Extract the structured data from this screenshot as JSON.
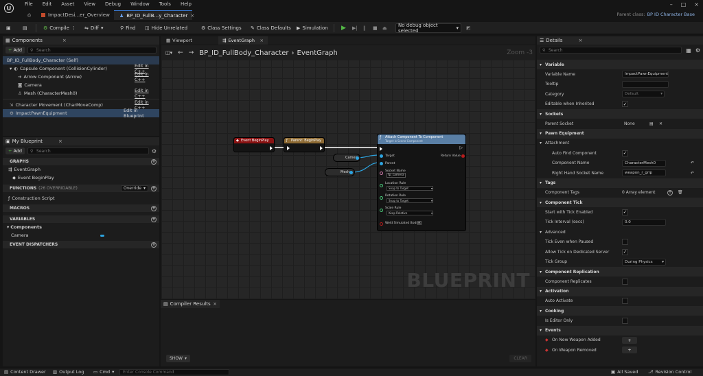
{
  "menu": [
    "File",
    "Edit",
    "Asset",
    "View",
    "Debug",
    "Window",
    "Tools",
    "Help"
  ],
  "doc_tabs": [
    {
      "label": "ImpactDesi...er_Overview"
    },
    {
      "label": "BP_ID_FullB...y_Character"
    }
  ],
  "parent_class": {
    "label": "Parent class:",
    "value": "BP ID Character Base"
  },
  "toolbar": {
    "compile": "Compile",
    "diff": "Diff",
    "find": "Find",
    "hide_unrelated": "Hide Unrelated",
    "class_settings": "Class Settings",
    "class_defaults": "Class Defaults",
    "simulation": "Simulation",
    "debug_object": "No debug object selected"
  },
  "components": {
    "title": "Components",
    "add": "Add",
    "search_placeholder": "Search",
    "items": [
      {
        "label": "BP_ID_FullBody_Character (Self)",
        "edit": ""
      },
      {
        "label": "Capsule Component (CollisionCylinder)",
        "edit": "Edit in C++"
      },
      {
        "label": "Arrow Component (Arrow)",
        "edit": "Edit in C++"
      },
      {
        "label": "Camera",
        "edit": ""
      },
      {
        "label": "Mesh (CharacterMesh0)",
        "edit": "Edit in C++"
      },
      {
        "label": "Character Movement (CharMoveComp)",
        "edit": "Edit in C++"
      },
      {
        "label": "ImpactPawnEquipment",
        "edit": "Edit in Blueprint"
      }
    ]
  },
  "my_blueprint": {
    "title": "My Blueprint",
    "add": "Add",
    "search_placeholder": "Search",
    "graphs": "GRAPHS",
    "event_graph": "EventGraph",
    "event_begin_play": "Event BeginPlay",
    "functions": "FUNCTIONS",
    "functions_note": "(26 OVERRIDABLE)",
    "override": "Override",
    "construction_script": "Construction Script",
    "macros": "MACROS",
    "variables": "VARIABLES",
    "components_cat": "Components",
    "camera_var": "Camera",
    "event_dispatchers": "EVENT DISPATCHERS"
  },
  "graph": {
    "tab_viewport": "Viewport",
    "tab_event_graph": "EventGraph",
    "breadcrumb_bp": "BP_ID_FullBody_Character",
    "breadcrumb_sep": "›",
    "breadcrumb_graph": "EventGraph",
    "zoom": "Zoom -3",
    "watermark": "BLUEPRINT",
    "nodes": {
      "begin_play": "Event BeginPlay",
      "parent_begin_play": "Parent: BeginPlay",
      "attach_title": "Attach Component To Component",
      "attach_subtitle": "Target is Scene Component",
      "target": "Target",
      "parent": "Parent",
      "return_value": "Return Value",
      "socket_name": "Socket Name",
      "socket_value": "fp_camera",
      "location_rule": "Location Rule",
      "rotation_rule": "Rotation Rule",
      "scale_rule": "Scale Rule",
      "snap_to_target": "Snap to Target",
      "keep_relative": "Keep Relative",
      "weld": "Weld Simulated Bodies",
      "camera": "Camera",
      "mesh": "Mesh"
    }
  },
  "compiler": {
    "title": "Compiler Results",
    "show": "SHOW",
    "clear": "CLEAR"
  },
  "details": {
    "title": "Details",
    "search_placeholder": "Search",
    "variable": "Variable",
    "variable_name_label": "Variable Name",
    "variable_name": "ImpactPawnEquipment",
    "tooltip": "Tooltip",
    "category": "Category",
    "category_value": "Default",
    "editable_inherited": "Editable when Inherited",
    "sockets": "Sockets",
    "parent_socket": "Parent Socket",
    "parent_socket_value": "None",
    "pawn_equipment": "Pawn Equipment",
    "attachment": "Attachment",
    "auto_find": "Auto Find Component",
    "component_name": "Component Name",
    "component_name_value": "CharacterMesh0",
    "rh_socket": "Right Hand Socket Name",
    "rh_socket_value": "weapon_r_grip",
    "tags": "Tags",
    "component_tags": "Component Tags",
    "tags_value": "0 Array element",
    "component_tick": "Component Tick",
    "start_tick": "Start with Tick Enabled",
    "tick_interval": "Tick Interval (secs)",
    "tick_interval_value": "0.0",
    "advanced": "Advanced",
    "tick_paused": "Tick Even when Paused",
    "tick_dedicated": "Allow Tick on Dedicated Server",
    "tick_group": "Tick Group",
    "tick_group_value": "During Physics",
    "component_replication": "Component Replication",
    "component_replicates": "Component Replicates",
    "activation": "Activation",
    "auto_activate": "Auto Activate",
    "cooking": "Cooking",
    "editor_only": "Is Editor Only",
    "events": "Events",
    "on_new_weapon": "On New Weapon Added",
    "on_weapon_removed": "On Weapon Removed"
  },
  "status": {
    "content_drawer": "Content Drawer",
    "output_log": "Output Log",
    "cmd": "Cmd",
    "console_placeholder": "Enter Console Command",
    "all_saved": "All Saved",
    "revision_control": "Revision Control"
  },
  "colors": {
    "accent": "#3a7bd5",
    "play": "#53b845",
    "event_node": "#8a1212",
    "function_node": "#5a7fa5"
  }
}
